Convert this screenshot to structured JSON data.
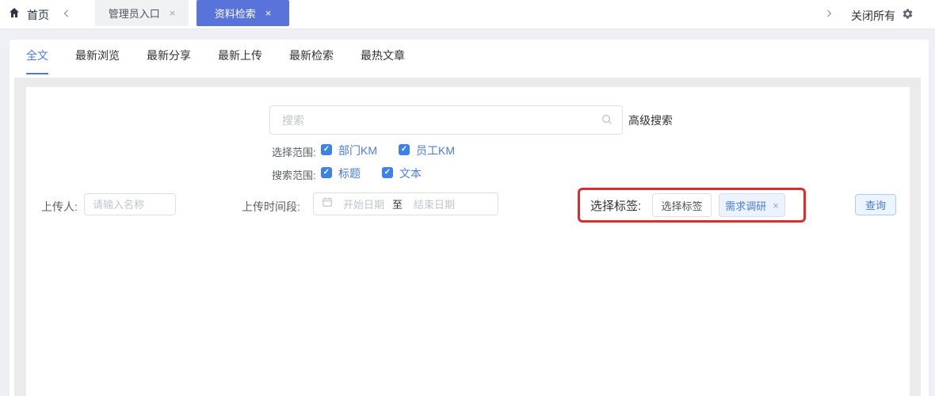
{
  "colors": {
    "accent_blue": "#4a7be0",
    "active_topbar_tab_blue": "#5873d9",
    "checkbox_blue": "#3d82e8",
    "highlight_red": "#e02b2b",
    "tag_chip_bg": "#ecf3fd",
    "query_button_bg": "#ecf4fe",
    "page_bg": "#eef0f5"
  },
  "topbar": {
    "home": {
      "label": "首页",
      "icon": "home-icon"
    },
    "tabs": [
      {
        "label": "管理员入口",
        "close": "×",
        "active": false
      },
      {
        "label": "资料检索",
        "close": "×",
        "active": true
      }
    ],
    "close_all_label": "关闭所有"
  },
  "nav_tabs": [
    {
      "label": "全文",
      "active": true
    },
    {
      "label": "最新浏览",
      "active": false
    },
    {
      "label": "最新分享",
      "active": false
    },
    {
      "label": "最新上传",
      "active": false
    },
    {
      "label": "最新检索",
      "active": false
    },
    {
      "label": "最热文章",
      "active": false
    }
  ],
  "search": {
    "placeholder": "搜索",
    "advanced_label": "高级搜索"
  },
  "select_scope": {
    "label": "选择范围:",
    "options": [
      {
        "label": "部门KM",
        "checked": true
      },
      {
        "label": "员工KM",
        "checked": true
      }
    ]
  },
  "search_scope": {
    "label": "搜索范围:",
    "options": [
      {
        "label": "标题",
        "checked": true
      },
      {
        "label": "文本",
        "checked": true
      }
    ]
  },
  "uploader": {
    "label": "上传人:",
    "placeholder": "请输入名称"
  },
  "upload_period": {
    "label": "上传时间段:",
    "start_placeholder": "开始日期",
    "separator": "至",
    "end_placeholder": "结束日期"
  },
  "tag_select": {
    "label": "选择标签:",
    "button_label": "选择标签",
    "selected_tag": {
      "name": "需求调研",
      "close": "×"
    }
  },
  "query_button_label": "查询"
}
